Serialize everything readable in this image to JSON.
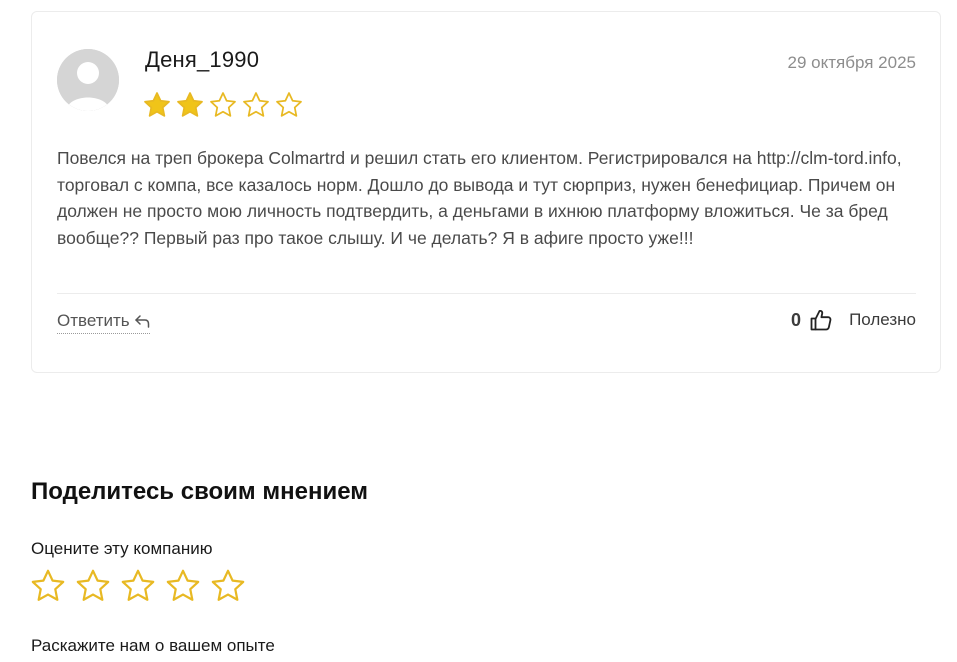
{
  "review": {
    "author": "Деня_1990",
    "date": "29 октября 2025",
    "rating": 2,
    "max_rating": 5,
    "text": "Повелся на треп брокера Colmartrd и решил стать его клиентом. Регистрировался на http://clm-tord.info, торговал с компа, все казалось норм. Дошло до вывода и тут сюрприз, нужен бенефициар. Причем он должен не просто мою личность подтвердить, а деньгами в ихнюю платформу вложиться. Че за бред вообще?? Первый раз про такое слышу. И че делать? Я в афиге просто уже!!!",
    "reply_label": "Ответить",
    "useful_count": "0",
    "useful_label": "Полезно"
  },
  "form": {
    "title": "Поделитесь своим мнением",
    "rate_label": "Оцените эту компанию",
    "rate_value": 0,
    "experience_label": "Раскажите нам о вашем опыте"
  },
  "colors": {
    "star": "#f0c419",
    "star_outline": "#e8b923",
    "avatar_bg": "#d5d5d5",
    "border": "#ececec"
  },
  "icons": {
    "avatar": "user-placeholder-icon",
    "star": "star-icon",
    "reply": "reply-arrow-icon",
    "thumb": "thumbs-up-icon"
  }
}
